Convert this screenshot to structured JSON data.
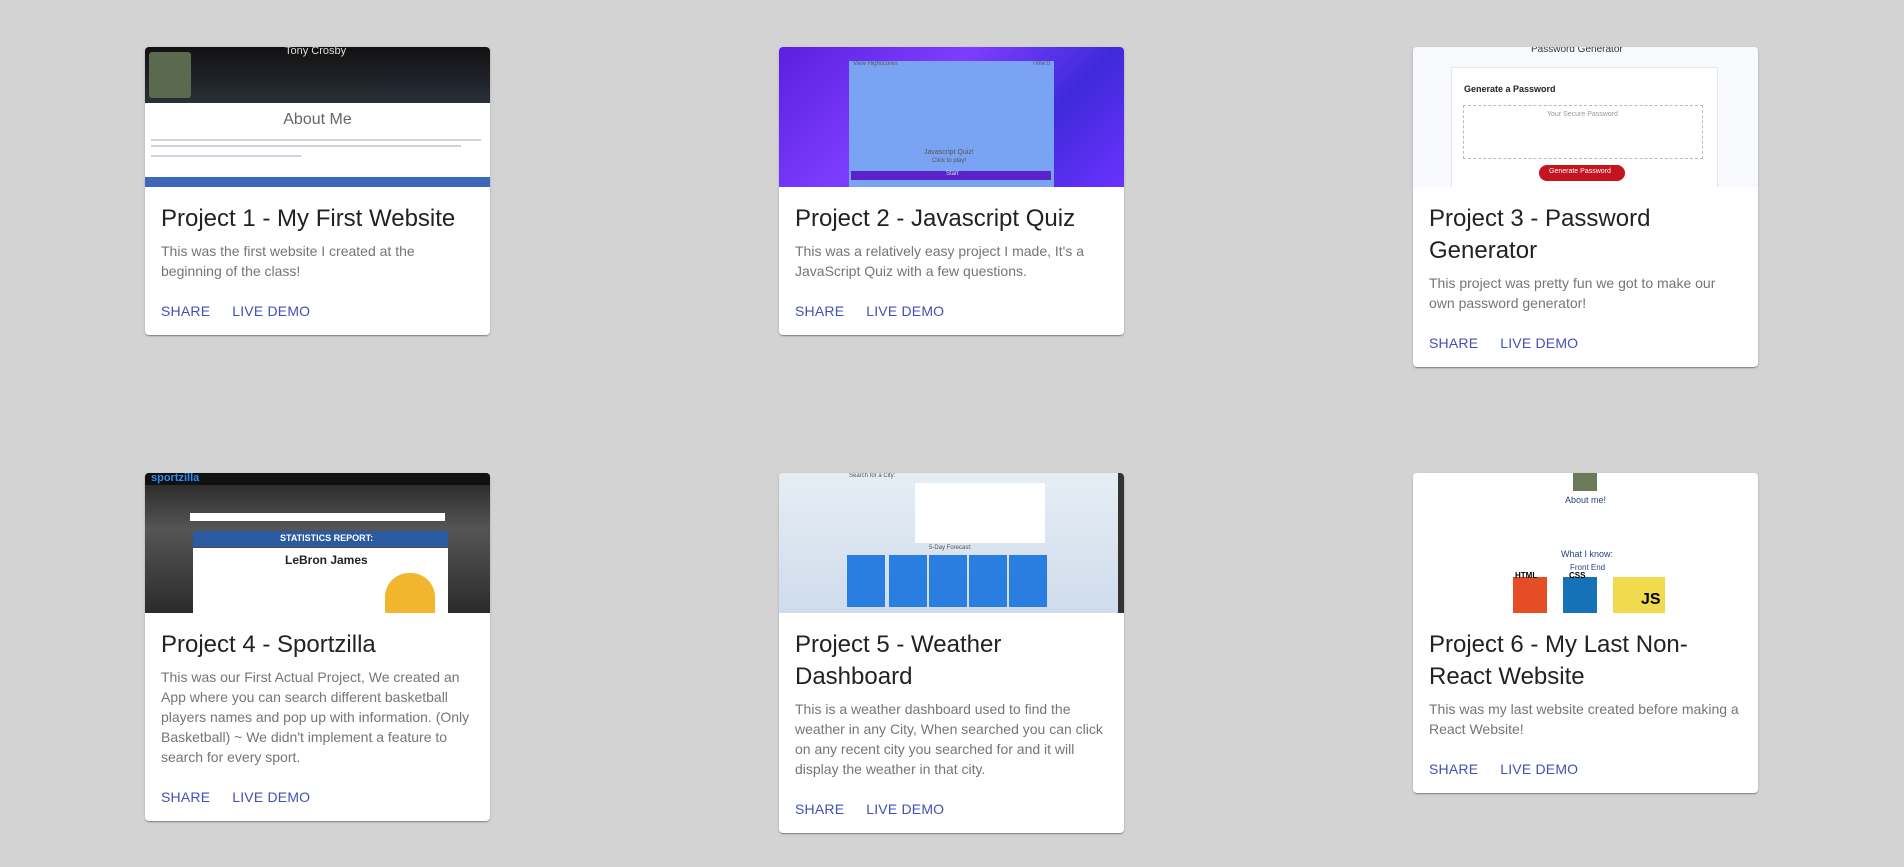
{
  "cards": [
    {
      "title": "Project 1 - My First Website",
      "description": "This was the first website I created at the beginning of the class!",
      "share": "SHARE",
      "demo": "LIVE DEMO",
      "thumb": {
        "name": "Tony Crosby",
        "heading": "About Me"
      }
    },
    {
      "title": "Project 2 - Javascript Quiz",
      "description": "This was a relatively easy project I made, It's a JavaScript Quiz with a few questions.",
      "share": "SHARE",
      "demo": "LIVE DEMO",
      "thumb": {
        "left": "View Highscores",
        "right": "Time:0",
        "line1": "Javascript Quiz!",
        "line2": "Click to play!",
        "button": "Start"
      }
    },
    {
      "title": "Project 3 - Password Generator",
      "description": "This project was pretty fun we got to make our own password generator!",
      "share": "SHARE",
      "demo": "LIVE DEMO",
      "thumb": {
        "top": "Password Generator",
        "heading": "Generate a Password",
        "placeholder": "Your Secure Password",
        "button": "Generate Password"
      }
    },
    {
      "title": "Project 4 - Sportzilla",
      "description": "This was our First Actual Project, We created an App where you can search different basketball players names and pop up with information. (Only Basketball) ~ We didn't implement a feature to search for every sport.",
      "share": "SHARE",
      "demo": "LIVE DEMO",
      "thumb": {
        "logo": "sportzilla",
        "report": "STATISTICS REPORT:",
        "player": "LeBron James"
      }
    },
    {
      "title": "Project 5 - Weather Dashboard",
      "description": "This is a weather dashboard used to find the weather in any City, When searched you can click on any recent city you searched for and it will display the weather in that city.",
      "share": "SHARE",
      "demo": "LIVE DEMO",
      "thumb": {
        "search": "Search for a City:",
        "forecast": "5-Day Forecast:"
      }
    },
    {
      "title": "Project 6 - My Last Non-React Website",
      "description": "This was my last website created before making a React Website!",
      "share": "SHARE",
      "demo": "LIVE DEMO",
      "thumb": {
        "about": "About me!",
        "know": "What I know:",
        "front": "Front End",
        "html": "HTML",
        "css": "CSS",
        "js": "JS"
      }
    }
  ]
}
